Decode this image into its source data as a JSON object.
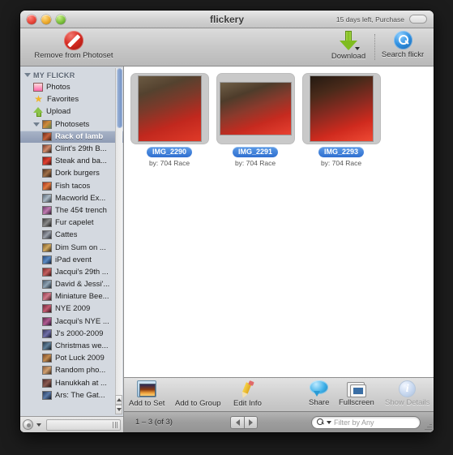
{
  "window": {
    "title": "flickery",
    "trial_text": "15 days left, Purchase"
  },
  "toolbar": {
    "remove_label": "Remove from Photoset",
    "download_label": "Download",
    "search_label": "Search flickr"
  },
  "sidebar": {
    "group_label": "MY FLICKR",
    "top_items": [
      {
        "label": "Photos",
        "icon": "photos-icon"
      },
      {
        "label": "Favorites",
        "icon": "star-icon"
      },
      {
        "label": "Upload",
        "icon": "upload-icon"
      }
    ],
    "photosets_label": "Photosets",
    "photosets": [
      {
        "label": "Rack of lamb",
        "selected": true
      },
      {
        "label": "Clint's 29th B...",
        "selected": false
      },
      {
        "label": "Steak and ba...",
        "selected": false
      },
      {
        "label": "Dork burgers",
        "selected": false
      },
      {
        "label": "Fish tacos",
        "selected": false
      },
      {
        "label": "Macworld Ex...",
        "selected": false
      },
      {
        "label": "The 45¢ trench",
        "selected": false
      },
      {
        "label": "Fur capelet",
        "selected": false
      },
      {
        "label": "Cattes",
        "selected": false
      },
      {
        "label": "Dim Sum on ...",
        "selected": false
      },
      {
        "label": "iPad event",
        "selected": false
      },
      {
        "label": "Jacqui's 29th ...",
        "selected": false
      },
      {
        "label": "David & Jessi'...",
        "selected": false
      },
      {
        "label": "Miniature Bee...",
        "selected": false
      },
      {
        "label": "NYE 2009",
        "selected": false
      },
      {
        "label": "Jacqui's NYE ...",
        "selected": false
      },
      {
        "label": "J's 2000-2009",
        "selected": false
      },
      {
        "label": "Christmas we...",
        "selected": false
      },
      {
        "label": "Pot Luck 2009",
        "selected": false
      },
      {
        "label": "Random pho...",
        "selected": false
      },
      {
        "label": "Hanukkah at ...",
        "selected": false
      },
      {
        "label": "Ars: The Gat...",
        "selected": false
      }
    ]
  },
  "photos": [
    {
      "title": "IMG_2290",
      "byline": "by: 704 Race",
      "orientation": "portrait"
    },
    {
      "title": "IMG_2291",
      "byline": "by: 704 Race",
      "orientation": "landscape"
    },
    {
      "title": "IMG_2293",
      "byline": "by: 704 Race",
      "orientation": "portrait"
    }
  ],
  "bottom_toolbar": {
    "add_to_set": "Add to Set",
    "add_to_group": "Add to Group",
    "edit_info": "Edit Info",
    "share": "Share",
    "fullscreen": "Fullscreen",
    "show_details": "Show Details"
  },
  "status": {
    "count": "1 – 3 (of 3)",
    "filter_placeholder": "Filter by Any"
  },
  "colors": {
    "selection_blue": "#8e9bb4",
    "title_badge_blue": "#2f6fd0",
    "sidebar_bg": "#d4d9e0"
  }
}
